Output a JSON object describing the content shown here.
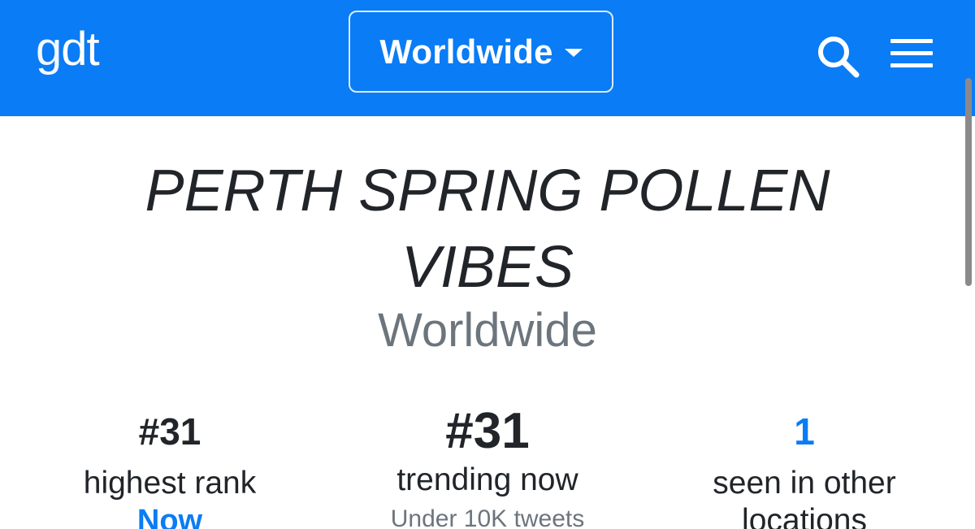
{
  "header": {
    "logo_g": "g",
    "logo_dt": "dt",
    "location_label": "Worldwide",
    "brand_color": "#0a7cf5",
    "icons": [
      "caret-down-icon",
      "search-icon",
      "menu-icon"
    ]
  },
  "trend": {
    "title_line1": "PERTH SPRING POLLEN",
    "title_line2": "VIBES",
    "location": "Worldwide"
  },
  "stats": {
    "highest_rank": {
      "value": "#31",
      "label": "highest rank",
      "sub": "Now"
    },
    "trending_now": {
      "value": "#31",
      "label": "trending now",
      "sub": "Under 10K tweets"
    },
    "other_locations": {
      "value": "1",
      "label": "seen in other",
      "label_cont": "locations"
    }
  }
}
